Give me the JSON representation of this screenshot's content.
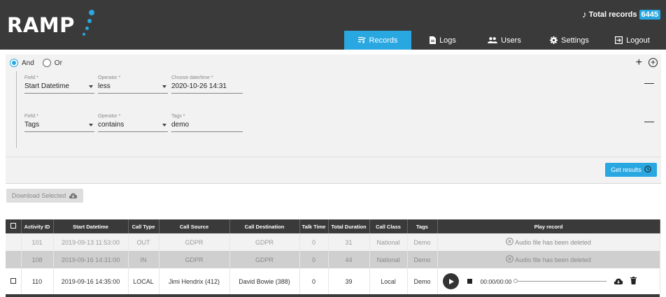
{
  "brand": {
    "name": "RAMP",
    "accent": "#28a7e1",
    "header_bg": "#3a3a3a"
  },
  "header": {
    "total_label": "Total records",
    "total_count": "6445",
    "nav": [
      {
        "label": "Records",
        "icon": "playlist-icon",
        "active": true
      },
      {
        "label": "Logs",
        "icon": "document-icon",
        "active": false
      },
      {
        "label": "Users",
        "icon": "users-icon",
        "active": false
      },
      {
        "label": "Settings",
        "icon": "gear-icon",
        "active": false
      },
      {
        "label": "Logout",
        "icon": "logout-icon",
        "active": false
      }
    ]
  },
  "filter": {
    "logic": {
      "and_label": "And",
      "or_label": "Or",
      "selected": "And"
    },
    "rules": [
      {
        "field_label": "Field *",
        "field_value": "Start Datetime",
        "operator_label": "Operator *",
        "operator_value": "less",
        "value_label": "Choose date/time *",
        "value": "2020-10-26 14:31"
      },
      {
        "field_label": "Field *",
        "field_value": "Tags",
        "operator_label": "Operator *",
        "operator_value": "contains",
        "value_label": "Tags *",
        "value": "demo"
      }
    ],
    "get_results_label": "Get results"
  },
  "download_selected_label": "Download Selected",
  "table": {
    "columns": [
      "",
      "Activity ID",
      "Start Datetime",
      "Call Type",
      "Call Source",
      "Call Destination",
      "Talk Time",
      "Total Duration",
      "Call Class",
      "Tags",
      "Play record"
    ],
    "rows": [
      {
        "id": "101",
        "start": "2019-09-13 11:53:00",
        "type": "OUT",
        "source": "GDPR",
        "destination": "GDPR",
        "talk": "0",
        "duration": "31",
        "class": "National",
        "tags": "Demo",
        "play": "Audio file has been deleted"
      },
      {
        "id": "108",
        "start": "2019-09-16 14:31:00",
        "type": "IN",
        "source": "GDPR",
        "destination": "GDPR",
        "talk": "0",
        "duration": "44",
        "class": "National",
        "tags": "Demo",
        "play": "Audio file has been deleted"
      },
      {
        "id": "110",
        "start": "2019-09-16 14:35:00",
        "type": "LOCAL",
        "source": "Jimi Hendrix (412)",
        "destination": "David Bowie (388)",
        "talk": "0",
        "duration": "39",
        "class": "Local",
        "tags": "Demo",
        "player_time": "00:00/00:00"
      }
    ]
  }
}
